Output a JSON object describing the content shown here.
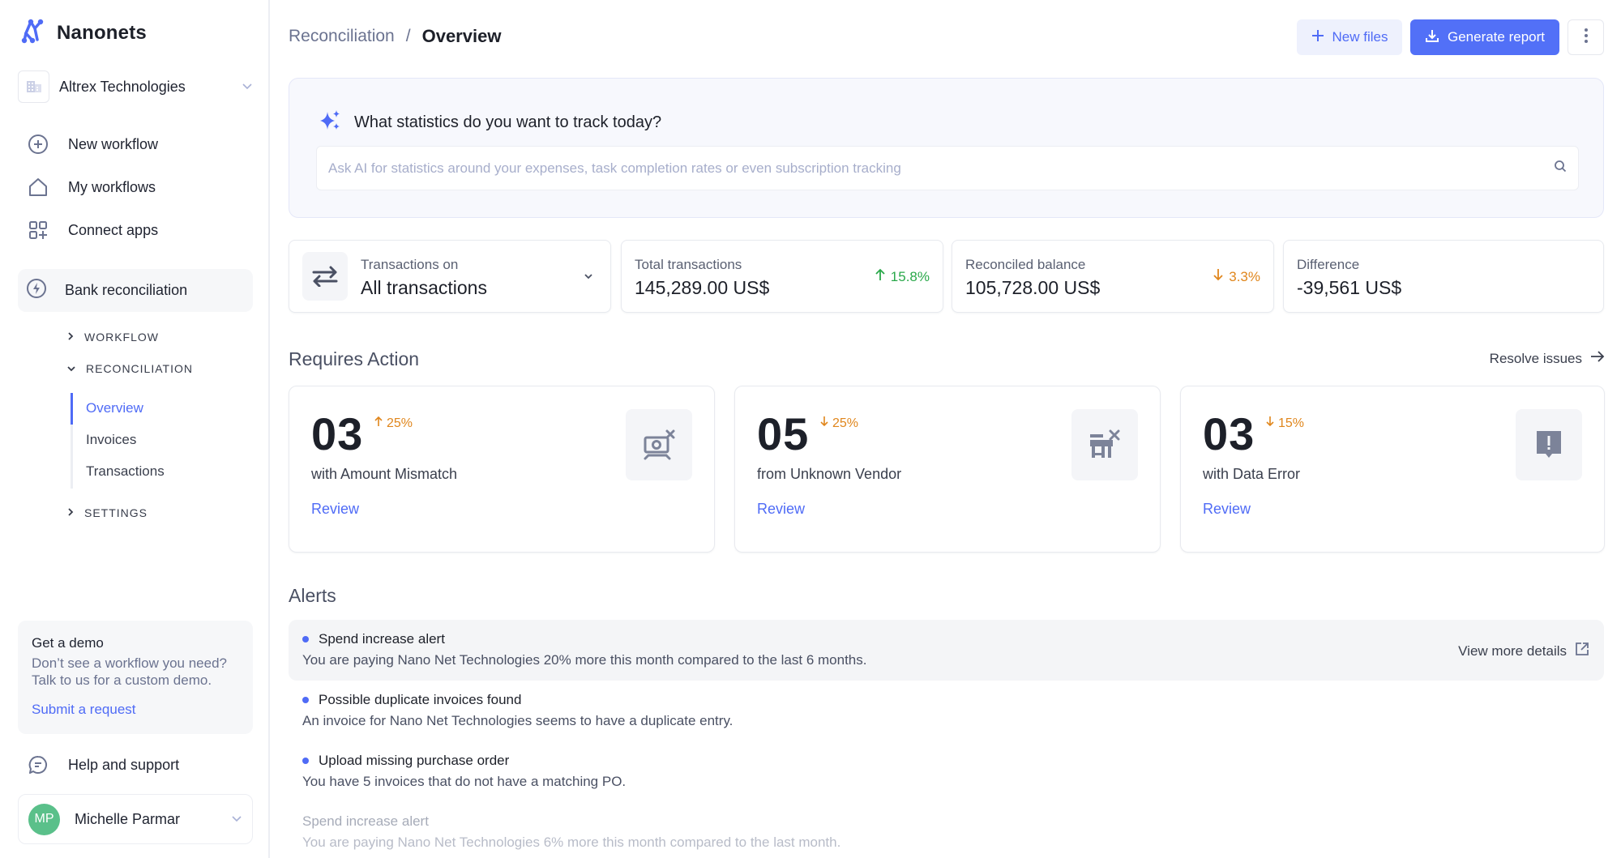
{
  "sidebar": {
    "brand": "Nanonets",
    "organization": "Altrex Technologies",
    "nav": [
      {
        "label": "New workflow",
        "icon": "plus-circle-icon"
      },
      {
        "label": "My workflows",
        "icon": "home-icon"
      },
      {
        "label": "Connect apps",
        "icon": "apps-add-icon"
      }
    ],
    "active_section": {
      "label": "Bank reconciliation",
      "icon": "lightning-icon"
    },
    "groups": [
      {
        "label": "WORKFLOW",
        "expanded": false
      },
      {
        "label": "RECONCILIATION",
        "expanded": true
      },
      {
        "label": "SETTINGS",
        "expanded": false
      }
    ],
    "sub_items": [
      {
        "label": "Overview",
        "active": true
      },
      {
        "label": "Invoices",
        "active": false
      },
      {
        "label": "Transactions",
        "active": false
      }
    ],
    "demo": {
      "title": "Get a demo",
      "text_line1": "Don’t see a workflow you need?",
      "text_line2": "Talk to us for a custom demo.",
      "link": "Submit a request"
    },
    "help": "Help and support",
    "user": {
      "initials": "MP",
      "name": "Michelle Parmar"
    }
  },
  "header": {
    "breadcrumb_parent": "Reconciliation",
    "breadcrumb_sep": "/",
    "breadcrumb_current": "Overview",
    "new_files_label": "New files",
    "generate_report_label": "Generate report"
  },
  "ai": {
    "title": "What statistics do you want to track today?",
    "placeholder": "Ask AI for statistics around your expenses, task completion rates or even subscription tracking",
    "value": ""
  },
  "stats": {
    "selector": {
      "label": "Transactions on",
      "value": "All transactions"
    },
    "cards": [
      {
        "label": "Total transactions",
        "value": "145,289.00 US$",
        "delta": "15.8%",
        "direction": "up"
      },
      {
        "label": "Reconciled balance",
        "value": "105,728.00 US$",
        "delta": "3.3%",
        "direction": "down"
      },
      {
        "label": "Difference",
        "value": "-39,561 US$"
      }
    ]
  },
  "requires_action": {
    "title": "Requires Action",
    "resolve_label": "Resolve issues",
    "cards": [
      {
        "count": "03",
        "delta": "25%",
        "direction": "up",
        "label": "with Amount Mismatch",
        "action": "Review",
        "icon": "money-mismatch-icon"
      },
      {
        "count": "05",
        "delta": "25%",
        "direction": "down",
        "label": "from Unknown Vendor",
        "action": "Review",
        "icon": "store-remove-icon"
      },
      {
        "count": "03",
        "delta": "15%",
        "direction": "down",
        "label": "with Data Error",
        "action": "Review",
        "icon": "alert-message-icon"
      }
    ]
  },
  "alerts": {
    "title": "Alerts",
    "view_more_label": "View more details",
    "items": [
      {
        "title": "Spend increase alert",
        "text": "You are paying Nano Net Technologies 20% more this month compared to the last 6 months.",
        "unread": true
      },
      {
        "title": "Possible duplicate invoices found",
        "text": "An invoice for Nano Net Technologies seems to have a duplicate entry.",
        "unread": true
      },
      {
        "title": "Upload missing purchase order",
        "text": "You have 5 invoices that do not have a matching PO.",
        "unread": true
      },
      {
        "title": "Spend increase alert",
        "text": "You are paying Nano Net Technologies 6% more this month compared to the last month.",
        "unread": false
      }
    ]
  },
  "colors": {
    "accent": "#5270f7",
    "positive": "#2aa84a",
    "warning": "#e0861c",
    "avatar": "#5ac08a"
  }
}
